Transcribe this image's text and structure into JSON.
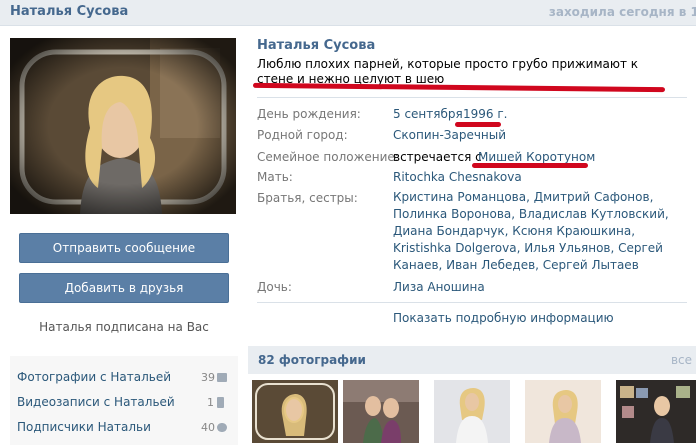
{
  "header": {
    "name": "Наталья Сусова",
    "last_seen": "заходила сегодня в 1:3"
  },
  "actions": {
    "send_message": "Отправить сообщение",
    "add_friend": "Добавить в друзья",
    "subscribed_note": "Наталья подписана на Вас"
  },
  "sidebar": {
    "items": [
      {
        "label": "Фотографии с Натальей",
        "count": "39"
      },
      {
        "label": "Видеозаписи с Натальей",
        "count": "1"
      },
      {
        "label": "Подписчики Натальи",
        "count": "40"
      }
    ]
  },
  "profile": {
    "name": "Наталья Сусова",
    "status_text": "Люблю плохих парней, которые просто грубо прижимают к стене и нежно целуют в шею",
    "fields": {
      "birthday": {
        "label": "День рождения:",
        "day": "5 сентября",
        "year": "1996 г."
      },
      "hometown": {
        "label": "Родной город:",
        "value": "Скопин-Заречный"
      },
      "relationship": {
        "label": "Семейное положение:",
        "prefix": "встречается с",
        "partner": "Мишей Коротуном"
      },
      "mother": {
        "label": "Мать:",
        "value": "Ritochka Chesnakova"
      },
      "siblings": {
        "label": "Братья, сестры:",
        "value": "Кристина Романцова, Дмитрий Сафонов, Полинка Воронова, Владислав Кутловский, Диана Бондарчук, Ксюня Краюшкина, Kristishka Dolgerova, Илья Ульянов, Сергей Канаев, Иван Лебедев, Сергей Лытаев"
      },
      "daughter": {
        "label": "Дочь:",
        "value": "Лиза Аношина"
      }
    },
    "show_more": "Показать подробную информацию"
  },
  "photos": {
    "title": "82 фотографии",
    "all_label": "все"
  },
  "colors": {
    "link": "#2b587a",
    "header_blue": "#45688e",
    "button": "#5b7fa6",
    "highlight_mark": "#d0071e"
  }
}
